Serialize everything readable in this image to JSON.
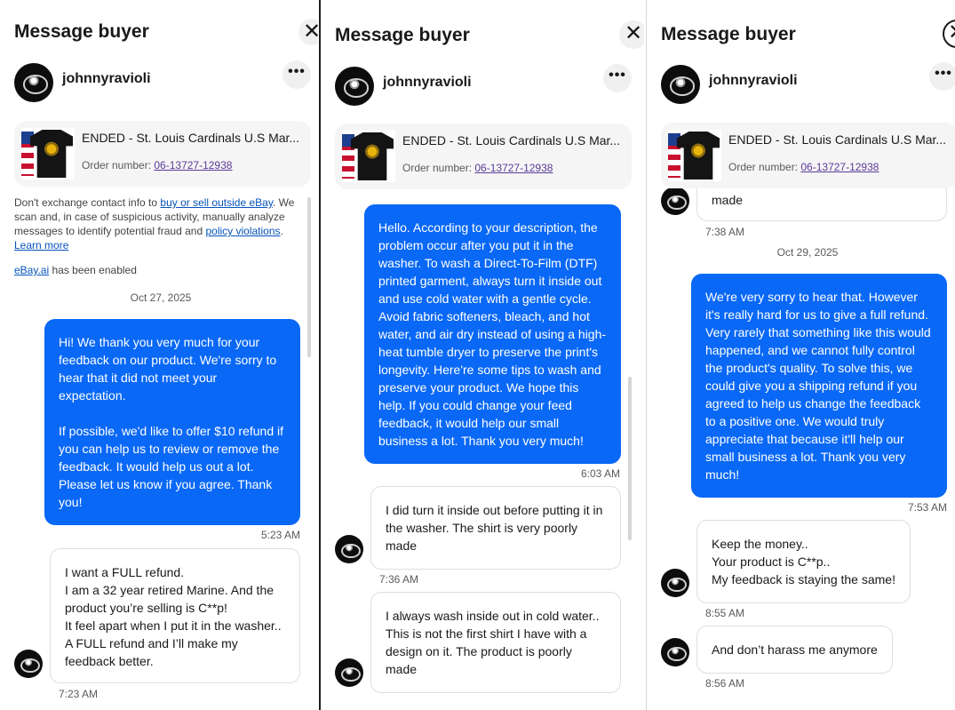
{
  "common": {
    "title": "Message buyer",
    "username": "johnnyravioli",
    "more_label": "•••",
    "close_label": "✕",
    "item_title": "ENDED - St. Louis Cardinals U.S Mar...",
    "order_label": "Order number: ",
    "order_number": "06-13727-12938"
  },
  "panel1": {
    "notice": {
      "t1": "Don't exchange contact info to ",
      "link1": "buy or sell outside eBay",
      "t2": ". We scan and, in case of suspicious activity, manually analyze messages to identify potential fraud and ",
      "link2": "policy violations",
      "t3": ". ",
      "link3": "Learn more"
    },
    "ai_link": "eBay.ai",
    "ai_text": " has been enabled",
    "date": "Oct 27, 2025",
    "msg_seller": "Hi! We thank you very much for your feedback on our product. We're sorry to hear that it did not meet your expectation.\n\nIf possible, we'd like to offer $10 refund if you can help us to review or remove the feedback. It would help us out a lot. Please let us know if you agree. Thank you!",
    "time_seller": "5:23 AM",
    "msg_buyer": "I want a FULL refund.\nI am a 32 year retired Marine. And the product you’re selling is C**p!\nIt feel apart when I put it in the washer..\nA FULL refund and I’ll make my feedback better.",
    "time_buyer": "7:23 AM"
  },
  "panel2": {
    "msg_seller": "Hello. According to your description, the problem occur after you put it in the washer. To wash a Direct-To-Film (DTF) printed garment, always turn it inside out and use cold water with a gentle cycle. Avoid fabric softeners, bleach, and hot water, and air dry instead of using a high-heat tumble dryer to preserve the print's longevity. Here're some tips to wash and preserve your product. We hope this help. If you could change your feed feedback, it would help our small business a lot. Thank you very much!",
    "time_seller": "6:03 AM",
    "msg_buyer1": "I did turn it inside out before putting it in the washer. The shirt is very poorly made",
    "time_buyer1": "7:36 AM",
    "msg_buyer2": "I always wash inside out in cold water.. This is not the first shirt I have with a design on it. The product is poorly made"
  },
  "panel3": {
    "msg_partial": "made",
    "time_partial": "7:38 AM",
    "date": "Oct 29, 2025",
    "msg_seller": "We're very sorry to hear that. However it's really hard for us to give a full refund. Very rarely that something like this would happened, and we cannot fully control the product's quality. To solve this, we could give you a shipping refund if you agreed to help us change the feedback to a positive one. We would truly appreciate that because it'll help our small business a lot. Thank you very much!",
    "time_seller": "7:53 AM",
    "msg_buyer1": "Keep the money..\nYour product is C**p..\nMy feedback is staying the same!",
    "time_buyer1": "8:55 AM",
    "msg_buyer2": "And don’t harass me anymore",
    "time_buyer2": "8:56 AM"
  },
  "colors": {
    "seller_bubble": "#0968f6",
    "link": "#0654ba",
    "order_link": "#5a3b9a"
  }
}
